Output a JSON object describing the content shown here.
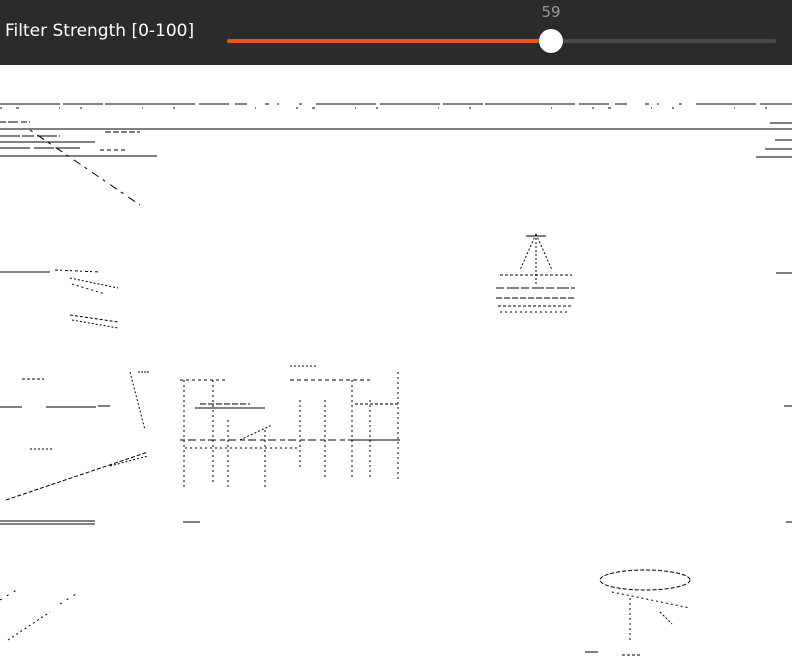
{
  "toolbar": {
    "label": "Filter Strength [0-100]",
    "slider": {
      "value": 59,
      "value_text": "59",
      "min": 0,
      "max": 100,
      "fill_color": "#e95420",
      "track_color": "#4a4a4a",
      "thumb_color": "#ffffff"
    }
  },
  "image_view": {
    "content": "edge-filtered image",
    "background": "#ffffff",
    "stroke": "#000000"
  }
}
